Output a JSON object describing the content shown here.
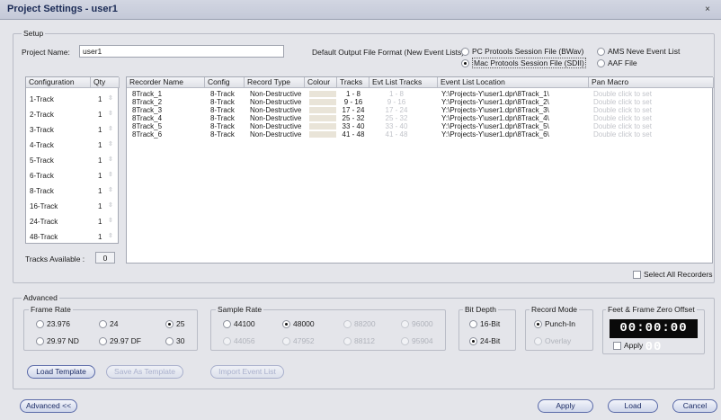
{
  "window": {
    "title": "Project Settings - user1",
    "close_glyph": "×"
  },
  "setup": {
    "group_label": "Setup",
    "project_name_label": "Project Name:",
    "project_name_value": "user1",
    "output_format_label": "Default Output File Format (New Event Lists) :",
    "formats": [
      {
        "label": "PC Protools Session File (BWav)",
        "selected": false
      },
      {
        "label": "AMS Neve Event List",
        "selected": false
      },
      {
        "label": "Mac Protools Session File (SDII)",
        "selected": true
      },
      {
        "label": "AAF File",
        "selected": false
      }
    ]
  },
  "config_table": {
    "headers": [
      "Configuration",
      "Qty"
    ],
    "rows": [
      {
        "config": "1-Track",
        "qty": "1"
      },
      {
        "config": "2-Track",
        "qty": "1"
      },
      {
        "config": "3-Track",
        "qty": "1"
      },
      {
        "config": "4-Track",
        "qty": "1"
      },
      {
        "config": "5-Track",
        "qty": "1"
      },
      {
        "config": "6-Track",
        "qty": "1"
      },
      {
        "config": "8-Track",
        "qty": "1"
      },
      {
        "config": "16-Track",
        "qty": "1"
      },
      {
        "config": "24-Track",
        "qty": "1"
      },
      {
        "config": "48-Track",
        "qty": "1"
      }
    ],
    "tracks_available_label": "Tracks Available :",
    "tracks_available_value": "0"
  },
  "recorder_table": {
    "headers": [
      "Recorder Name",
      "Config",
      "Record Type",
      "Colour",
      "Tracks",
      "Evt List Tracks",
      "Event List Location",
      "Pan Macro"
    ],
    "rows": [
      {
        "name": "8Track_1",
        "config": "8-Track",
        "type": "Non-Destructive",
        "tracks": "1 - 8",
        "evt": "1 - 8",
        "location": "Y:\\Projects-Y\\user1.dpr\\8Track_1\\",
        "pan": "Double click to set"
      },
      {
        "name": "8Track_2",
        "config": "8-Track",
        "type": "Non-Destructive",
        "tracks": "9 - 16",
        "evt": "9 - 16",
        "location": "Y:\\Projects-Y\\user1.dpr\\8Track_2\\",
        "pan": "Double click to set"
      },
      {
        "name": "8Track_3",
        "config": "8-Track",
        "type": "Non-Destructive",
        "tracks": "17 - 24",
        "evt": "17 - 24",
        "location": "Y:\\Projects-Y\\user1.dpr\\8Track_3\\",
        "pan": "Double click to set"
      },
      {
        "name": "8Track_4",
        "config": "8-Track",
        "type": "Non-Destructive",
        "tracks": "25 - 32",
        "evt": "25 - 32",
        "location": "Y:\\Projects-Y\\user1.dpr\\8Track_4\\",
        "pan": "Double click to set"
      },
      {
        "name": "8Track_5",
        "config": "8-Track",
        "type": "Non-Destructive",
        "tracks": "33 - 40",
        "evt": "33 - 40",
        "location": "Y:\\Projects-Y\\user1.dpr\\8Track_5\\",
        "pan": "Double click to set"
      },
      {
        "name": "8Track_6",
        "config": "8-Track",
        "type": "Non-Destructive",
        "tracks": "41 - 48",
        "evt": "41 - 48",
        "location": "Y:\\Projects-Y\\user1.dpr\\8Track_6\\",
        "pan": "Double click to set"
      }
    ],
    "select_all_label": "Select All Recorders"
  },
  "advanced": {
    "group_label": "Advanced",
    "frame_rate": {
      "label": "Frame Rate",
      "options": [
        {
          "label": "23.976",
          "selected": false
        },
        {
          "label": "24",
          "selected": false
        },
        {
          "label": "25",
          "selected": true
        },
        {
          "label": "29.97 ND",
          "selected": false
        },
        {
          "label": "29.97 DF",
          "selected": false
        },
        {
          "label": "30",
          "selected": false
        }
      ]
    },
    "sample_rate": {
      "label": "Sample Rate",
      "options": [
        {
          "label": "44100",
          "selected": false,
          "disabled": false
        },
        {
          "label": "48000",
          "selected": true,
          "disabled": false
        },
        {
          "label": "88200",
          "selected": false,
          "disabled": true
        },
        {
          "label": "96000",
          "selected": false,
          "disabled": true
        },
        {
          "label": "44056",
          "selected": false,
          "disabled": true
        },
        {
          "label": "47952",
          "selected": false,
          "disabled": true
        },
        {
          "label": "88112",
          "selected": false,
          "disabled": true
        },
        {
          "label": "95904",
          "selected": false,
          "disabled": true
        }
      ]
    },
    "bit_depth": {
      "label": "Bit Depth",
      "options": [
        {
          "label": "16-Bit",
          "selected": false
        },
        {
          "label": "24-Bit",
          "selected": true
        }
      ]
    },
    "record_mode": {
      "label": "Record Mode",
      "options": [
        {
          "label": "Punch-In",
          "selected": true,
          "disabled": false
        },
        {
          "label": "Overlay",
          "selected": false,
          "disabled": true
        }
      ]
    },
    "zero_offset": {
      "label": "Feet & Frame Zero Offset",
      "timecode": "00:00:00 00",
      "apply_label": "Apply"
    },
    "buttons": {
      "load_template": "Load Template",
      "save_as_template": "Save As Template",
      "import_event_list": "Import Event List"
    }
  },
  "footer": {
    "advanced_toggle": "Advanced <<",
    "apply": "Apply",
    "load": "Load",
    "cancel": "Cancel"
  }
}
